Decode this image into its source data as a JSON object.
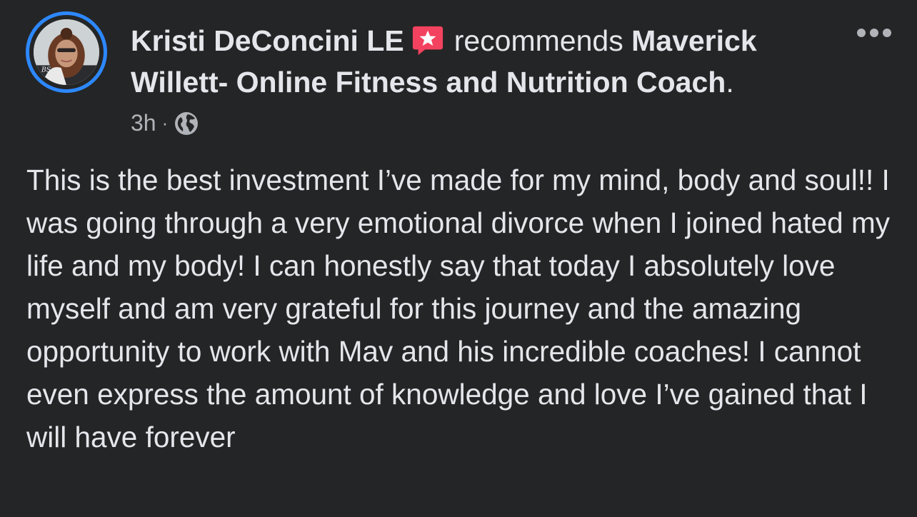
{
  "post": {
    "author": "Kristi DeConcini LE",
    "action_text": "recommends",
    "page_name": "Maverick Willett- Online Fitness and Nutrition Coach",
    "trailing_punct": ".",
    "timestamp": "3h",
    "separator": "·",
    "audience_icon": "globe-icon",
    "badge_icon": "recommendation-star-icon",
    "body": "This is the best investment I’ve made for my mind, body and soul!! I was going through a very emotional divorce when I joined hated my life and my body! I can honestly say that today I absolutely love myself and am very grateful for this journey and the amazing opportunity to work with Mav and his incredible coaches! I cannot even express the amount of knowledge and love I’ve gained that I will have forever"
  },
  "colors": {
    "background": "#242526",
    "primary_text": "#e4e6eb",
    "secondary_text": "#b0b3b8",
    "story_ring": "#2d88ff",
    "badge": "#f3425f"
  }
}
